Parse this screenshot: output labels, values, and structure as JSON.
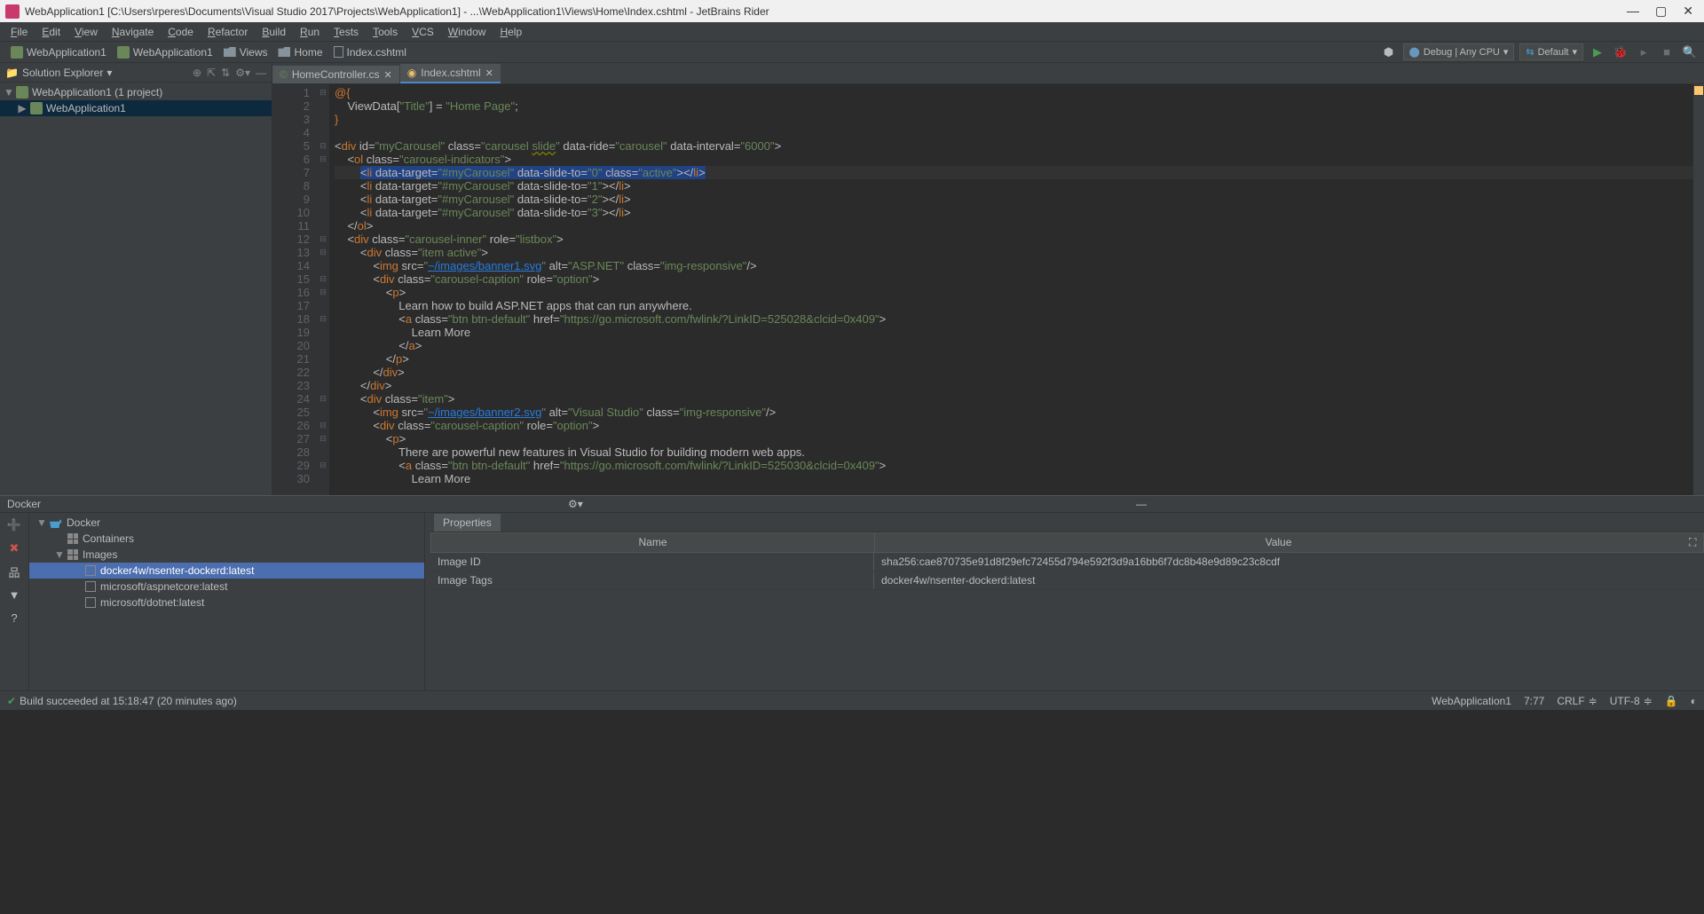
{
  "window": {
    "title": "WebApplication1 [C:\\Users\\rperes\\Documents\\Visual Studio 2017\\Projects\\WebApplication1] - ...\\WebApplication1\\Views\\Home\\Index.cshtml - JetBrains Rider"
  },
  "menu": [
    "File",
    "Edit",
    "View",
    "Navigate",
    "Code",
    "Refactor",
    "Build",
    "Run",
    "Tests",
    "Tools",
    "VCS",
    "Window",
    "Help"
  ],
  "breadcrumbs": [
    {
      "type": "project",
      "label": "WebApplication1"
    },
    {
      "type": "project",
      "label": "WebApplication1"
    },
    {
      "type": "folder",
      "label": "Views"
    },
    {
      "type": "folder",
      "label": "Home"
    },
    {
      "type": "file",
      "label": "Index.cshtml"
    }
  ],
  "run_config": {
    "debug": "Debug | Any CPU",
    "default": "Default"
  },
  "solution_panel": {
    "title": "Solution Explorer"
  },
  "solution_tree": [
    {
      "indent": 0,
      "label": "WebApplication1 (1 project)",
      "arrow": "▼",
      "icon": "sol"
    },
    {
      "indent": 1,
      "label": "WebApplication1",
      "arrow": "▶",
      "icon": "cs",
      "selected": true
    }
  ],
  "tabs": [
    {
      "label": "HomeController.cs",
      "active": false,
      "ftype": "cs"
    },
    {
      "label": "Index.cshtml",
      "active": true,
      "ftype": "html"
    }
  ],
  "code_lines": [
    {
      "n": 1,
      "html": "<span class='kw'>@{</span>"
    },
    {
      "n": 2,
      "html": "    ViewData[<span class='str'>\"Title\"</span>] = <span class='str'>\"Home Page\"</span>;"
    },
    {
      "n": 3,
      "html": "<span class='kw'>}</span>"
    },
    {
      "n": 4,
      "html": ""
    },
    {
      "n": 5,
      "html": "&lt;<span class='kw'>div</span> <span class='attr'>id</span>=<span class='attrval'>\"myCarousel\"</span> <span class='attr'>class</span>=<span class='attrval'>\"carousel <span class='warn'>slide</span>\"</span> <span class='attr'>data-ride</span>=<span class='attrval'>\"carousel\"</span> <span class='attr'>data-interval</span>=<span class='attrval'>\"6000\"</span>&gt;"
    },
    {
      "n": 6,
      "html": "    &lt;<span class='kw'>ol</span> <span class='attr'>class</span>=<span class='attrval'>\"carousel-indicators\"</span>&gt;"
    },
    {
      "n": 7,
      "hl": true,
      "html": "        <span class='sel'>&lt;<span class='kw'>li</span> <span class='attr'>data-target</span>=<span class='attrval'>\"#myCarousel\"</span> <span class='attr'>data-slide-to</span>=<span class='attrval'>\"0\"</span> <span class='attr'>class</span>=<span class='attrval'>\"active\"</span>&gt;&lt;/<span class='kw'>li</span>&gt;</span>"
    },
    {
      "n": 8,
      "html": "        &lt;<span class='kw'>li</span> <span class='attr'>data-target</span>=<span class='attrval'>\"#myCarousel\"</span> <span class='attr'>data-slide-to</span>=<span class='attrval'>\"1\"</span>&gt;&lt;/<span class='kw'>li</span>&gt;"
    },
    {
      "n": 9,
      "html": "        &lt;<span class='kw'>li</span> <span class='attr'>data-target</span>=<span class='attrval'>\"#myCarousel\"</span> <span class='attr'>data-slide-to</span>=<span class='attrval'>\"2\"</span>&gt;&lt;/<span class='kw'>li</span>&gt;"
    },
    {
      "n": 10,
      "html": "        &lt;<span class='kw'>li</span> <span class='attr'>data-target</span>=<span class='attrval'>\"#myCarousel\"</span> <span class='attr'>data-slide-to</span>=<span class='attrval'>\"3\"</span>&gt;&lt;/<span class='kw'>li</span>&gt;"
    },
    {
      "n": 11,
      "html": "    &lt;/<span class='kw'>ol</span>&gt;"
    },
    {
      "n": 12,
      "html": "    &lt;<span class='kw'>div</span> <span class='attr'>class</span>=<span class='attrval'>\"carousel-inner\"</span> <span class='attr'>role</span>=<span class='attrval'>\"listbox\"</span>&gt;"
    },
    {
      "n": 13,
      "html": "        &lt;<span class='kw'>div</span> <span class='attr'>class</span>=<span class='attrval'>\"item active\"</span>&gt;"
    },
    {
      "n": 14,
      "html": "            &lt;<span class='kw'>img</span> <span class='attr'>src</span>=<span class='attrval'>\"<span class='lnk'>~/images/banner1.svg</span>\"</span> <span class='attr'>alt</span>=<span class='attrval'>\"ASP.NET\"</span> <span class='attr'>class</span>=<span class='attrval'>\"img-responsive\"</span>/&gt;"
    },
    {
      "n": 15,
      "html": "            &lt;<span class='kw'>div</span> <span class='attr'>class</span>=<span class='attrval'>\"carousel-caption\"</span> <span class='attr'>role</span>=<span class='attrval'>\"option\"</span>&gt;"
    },
    {
      "n": 16,
      "html": "                &lt;<span class='kw'>p</span>&gt;"
    },
    {
      "n": 17,
      "html": "                    Learn how to build ASP.NET apps that can run anywhere."
    },
    {
      "n": 18,
      "html": "                    &lt;<span class='kw'>a</span> <span class='attr'>class</span>=<span class='attrval'>\"btn btn-default\"</span> <span class='attr'>href</span>=<span class='attrval'>\"https://go.microsoft.com/fwlink/?LinkID=525028&amp;clcid=0x409\"</span>&gt;"
    },
    {
      "n": 19,
      "html": "                        Learn More"
    },
    {
      "n": 20,
      "html": "                    &lt;/<span class='kw'>a</span>&gt;"
    },
    {
      "n": 21,
      "html": "                &lt;/<span class='kw'>p</span>&gt;"
    },
    {
      "n": 22,
      "html": "            &lt;/<span class='kw'>div</span>&gt;"
    },
    {
      "n": 23,
      "html": "        &lt;/<span class='kw'>div</span>&gt;"
    },
    {
      "n": 24,
      "html": "        &lt;<span class='kw'>div</span> <span class='attr'>class</span>=<span class='attrval'>\"item\"</span>&gt;"
    },
    {
      "n": 25,
      "html": "            &lt;<span class='kw'>img</span> <span class='attr'>src</span>=<span class='attrval'>\"<span class='lnk'>~/images/banner2.svg</span>\"</span> <span class='attr'>alt</span>=<span class='attrval'>\"Visual Studio\"</span> <span class='attr'>class</span>=<span class='attrval'>\"img-responsive\"</span>/&gt;"
    },
    {
      "n": 26,
      "html": "            &lt;<span class='kw'>div</span> <span class='attr'>class</span>=<span class='attrval'>\"carousel-caption\"</span> <span class='attr'>role</span>=<span class='attrval'>\"option\"</span>&gt;"
    },
    {
      "n": 27,
      "html": "                &lt;<span class='kw'>p</span>&gt;"
    },
    {
      "n": 28,
      "html": "                    There are powerful new features in Visual Studio for building modern web apps."
    },
    {
      "n": 29,
      "html": "                    &lt;<span class='kw'>a</span> <span class='attr'>class</span>=<span class='attrval'>\"btn btn-default\"</span> <span class='attr'>href</span>=<span class='attrval'>\"https://go.microsoft.com/fwlink/?LinkID=525030&amp;clcid=0x409\"</span>&gt;"
    },
    {
      "n": 30,
      "html": "                        Learn More"
    }
  ],
  "docker": {
    "title": "Docker",
    "tree": [
      {
        "indent": 0,
        "arrow": "▼",
        "icon": "whale",
        "label": "Docker"
      },
      {
        "indent": 1,
        "arrow": "",
        "icon": "grid",
        "label": "Containers"
      },
      {
        "indent": 1,
        "arrow": "▼",
        "icon": "grid",
        "label": "Images"
      },
      {
        "indent": 2,
        "arrow": "",
        "icon": "chk",
        "label": "docker4w/nsenter-dockerd:latest",
        "sel": true
      },
      {
        "indent": 2,
        "arrow": "",
        "icon": "chk",
        "label": "microsoft/aspnetcore:latest"
      },
      {
        "indent": 2,
        "arrow": "",
        "icon": "chk",
        "label": "microsoft/dotnet:latest"
      }
    ],
    "props_tab": "Properties",
    "columns": {
      "name": "Name",
      "value": "Value"
    },
    "rows": [
      {
        "name": "Image ID",
        "value": "sha256:cae870735e91d8f29efc72455d794e592f3d9a16bb6f7dc8b48e9d89c23c8cdf"
      },
      {
        "name": "Image Tags",
        "value": "docker4w/nsenter-dockerd:latest"
      }
    ]
  },
  "status": {
    "build": "Build succeeded at 15:18:47 (20 minutes ago)",
    "project": "WebApplication1",
    "caret": "7:77",
    "eol": "CRLF",
    "enc": "UTF-8"
  }
}
